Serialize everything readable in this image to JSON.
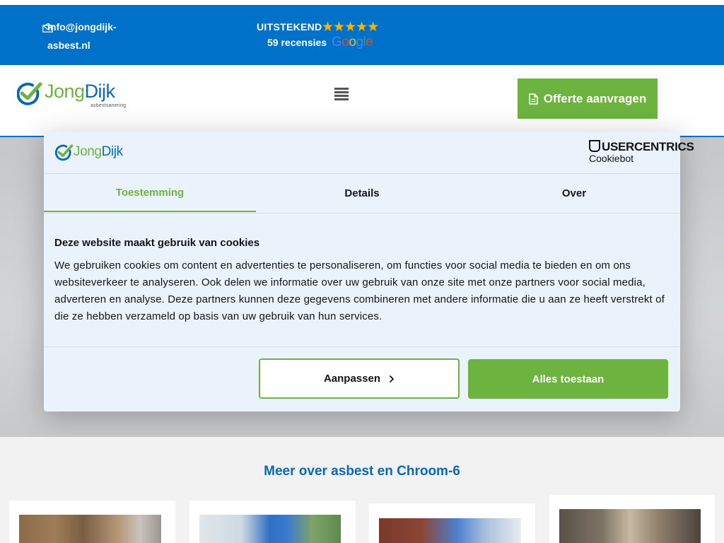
{
  "topbar": {
    "email": "info@jongdijk-asbest.nl",
    "rating_label": "UITSTEKEND",
    "stars": "★★★★★",
    "review_count": "59 recensies",
    "google_letters": [
      "G",
      "o",
      "o",
      "g",
      "l",
      "e"
    ],
    "google_colors": [
      "#4285F4",
      "#EA4335",
      "#FBBC05",
      "#4285F4",
      "#34A853",
      "#EA4335"
    ]
  },
  "header": {
    "logo_jong": "Jong",
    "logo_dijk": "Dijk",
    "logo_sub": "asbestsanering",
    "cta_label": "Offerte aanvragen"
  },
  "cookie": {
    "logo_jong": "Jong",
    "logo_dijk": "Dijk",
    "provider_name": "USERCENTRICS",
    "provider_sub": "Cookiebot",
    "tabs": [
      {
        "label": "Toestemming"
      },
      {
        "label": "Details"
      },
      {
        "label": "Over"
      }
    ],
    "title": "Deze website maakt gebruik van cookies",
    "body": "We gebruiken cookies om content en advertenties te personaliseren, om functies voor social media te bieden en om ons websiteverkeer te analyseren. Ook delen we informatie over uw gebruik van onze site met onze partners voor social media, adverteren en analyse. Deze partners kunnen deze gegevens combineren met andere informatie die u aan ze heeft verstrekt of die ze hebben verzameld op basis van uw gebruik van hun services.",
    "adjust_label": "Aanpassen",
    "allow_label": "Alles toestaan"
  },
  "section": {
    "title": "Meer over asbest en Chroom-6"
  },
  "colors": {
    "brand_blue": "#0071c9",
    "brand_green": "#6db33f"
  }
}
